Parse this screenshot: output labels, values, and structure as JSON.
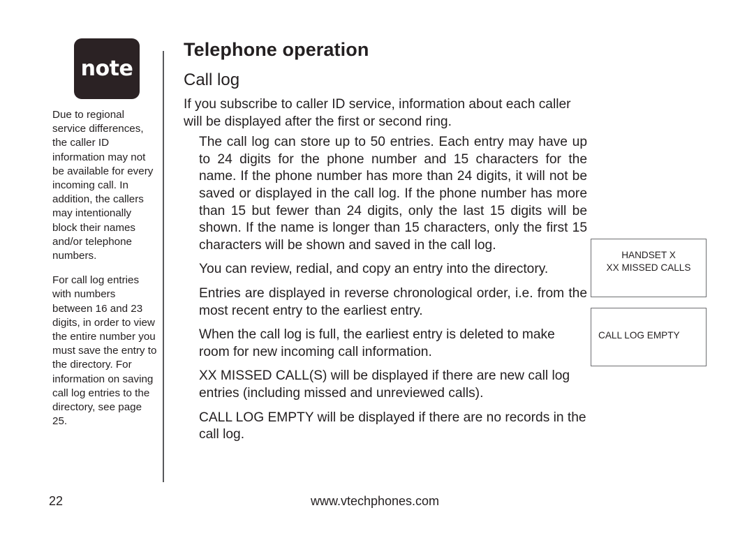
{
  "document": {
    "page_title": "Telephone operation",
    "section_title": "Call log"
  },
  "note": {
    "badge_label": "note",
    "paragraphs": [
      "Due to regional service differences, the caller ID information may not be available for every incoming call. In addition, the callers may intentionally block their names and/or telephone numbers.",
      "For call log entries with numbers between 16 and 23 digits, in order to view the entire number you must save the entry to the directory. For information on saving call log entries to the directory, see page 25."
    ]
  },
  "body": {
    "lead": "If you subscribe to caller ID service, information about each caller will be displayed after the first or second ring.",
    "paragraphs": [
      "The call log can store up to 50 entries. Each entry may have up to 24 digits for the phone number and 15 characters for the name. If the phone number has more than 24 digits, it will not be saved or displayed in the call log. If the phone number has more than 15 but fewer than 24 digits, only the last 15 digits will be shown. If the name is longer than 15 characters, only the first 15 characters will be shown and saved in the call log.",
      "You can review, redial, and copy an entry into the directory.",
      "Entries are displayed in reverse chronological order, i.e. from the most recent entry to the earliest entry.",
      "When the call log is full, the earliest entry is deleted to make room for new incoming call information.",
      "XX MISSED CALL(S)  will be displayed if there are new call log entries (including missed and unreviewed calls).",
      "CALL LOG EMPTY  will be displayed if there are no records in the call log."
    ]
  },
  "lcd_displays": [
    {
      "name": "handset-missed-calls",
      "line1": "HANDSET X",
      "line2": "XX MISSED CALLS"
    },
    {
      "name": "call-log-empty",
      "line1": "CALL LOG EMPTY",
      "line2": ""
    }
  ],
  "footer": {
    "page_number": "22",
    "url": "www.vtechphones.com"
  },
  "colors": {
    "text": "#231f20",
    "badge_background": "#2b2224",
    "divider": "#58595b",
    "lcd_border": "#6d6e71",
    "page_background": "#ffffff"
  }
}
